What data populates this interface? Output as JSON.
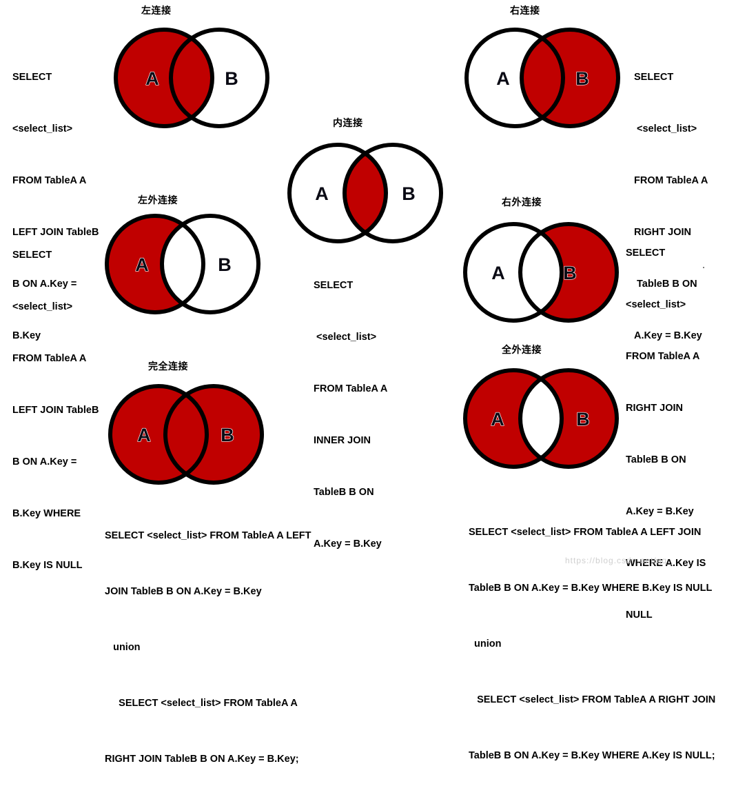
{
  "meta": {
    "colors": {
      "fill_red": "#C00000",
      "stroke_black": "#000000",
      "background": "#FFFFFF",
      "label_text": "#0A0A14"
    },
    "label_a": "A",
    "label_b": "B",
    "watermark": "https://blog.csdn.net/qq_"
  },
  "panels": {
    "left_join": {
      "title": "左连接",
      "region": "A-full (A plus intersection)",
      "sql_lines": [
        "SELECT",
        "<select_list>",
        "FROM TableA A",
        "LEFT JOIN TableB",
        "B ON A.Key =",
        "B.Key"
      ]
    },
    "right_join": {
      "title": "右连接",
      "region": "B-full (B plus intersection)",
      "sql_lines": [
        "SELECT",
        " <select_list>",
        "FROM TableA A",
        "RIGHT JOIN",
        " TableB B ON",
        "A.Key = B.Key"
      ]
    },
    "inner_join": {
      "title": "内连接",
      "region": "intersection only",
      "sql_lines": [
        "SELECT",
        " <select_list>",
        "FROM TableA A",
        "INNER JOIN",
        "TableB B ON",
        "A.Key = B.Key"
      ]
    },
    "left_outer_join": {
      "title": "左外连接",
      "region": "A minus intersection",
      "sql_lines": [
        "SELECT",
        "<select_list>",
        "FROM TableA A",
        "LEFT JOIN TableB",
        "B ON A.Key =",
        "B.Key WHERE",
        "B.Key IS NULL"
      ]
    },
    "right_outer_join": {
      "title": "右外连接",
      "region": "B minus intersection",
      "sql_lines": [
        "SELECT",
        "<select_list>",
        "FROM TableA A",
        "RIGHT JOIN",
        "TableB B ON",
        "A.Key = B.Key",
        "WHERE A.Key IS",
        "NULL"
      ]
    },
    "full_join": {
      "title": "完全连接",
      "region": "A union B (all filled)",
      "sql_lines": [
        "SELECT <select_list> FROM TableA A LEFT",
        "JOIN TableB B ON A.Key = B.Key",
        "   union",
        "     SELECT <select_list> FROM TableA A",
        "RIGHT JOIN TableB B ON A.Key = B.Key;"
      ]
    },
    "full_outer_join": {
      "title": "全外连接",
      "region": "A union B minus intersection",
      "sql_lines": [
        "SELECT <select_list> FROM TableA A LEFT JOIN",
        "TableB B ON A.Key = B.Key WHERE B.Key IS NULL",
        "  union",
        "   SELECT <select_list> FROM TableA A RIGHT JOIN",
        "TableB B ON A.Key = B.Key WHERE A.Key IS NULL;"
      ]
    }
  }
}
